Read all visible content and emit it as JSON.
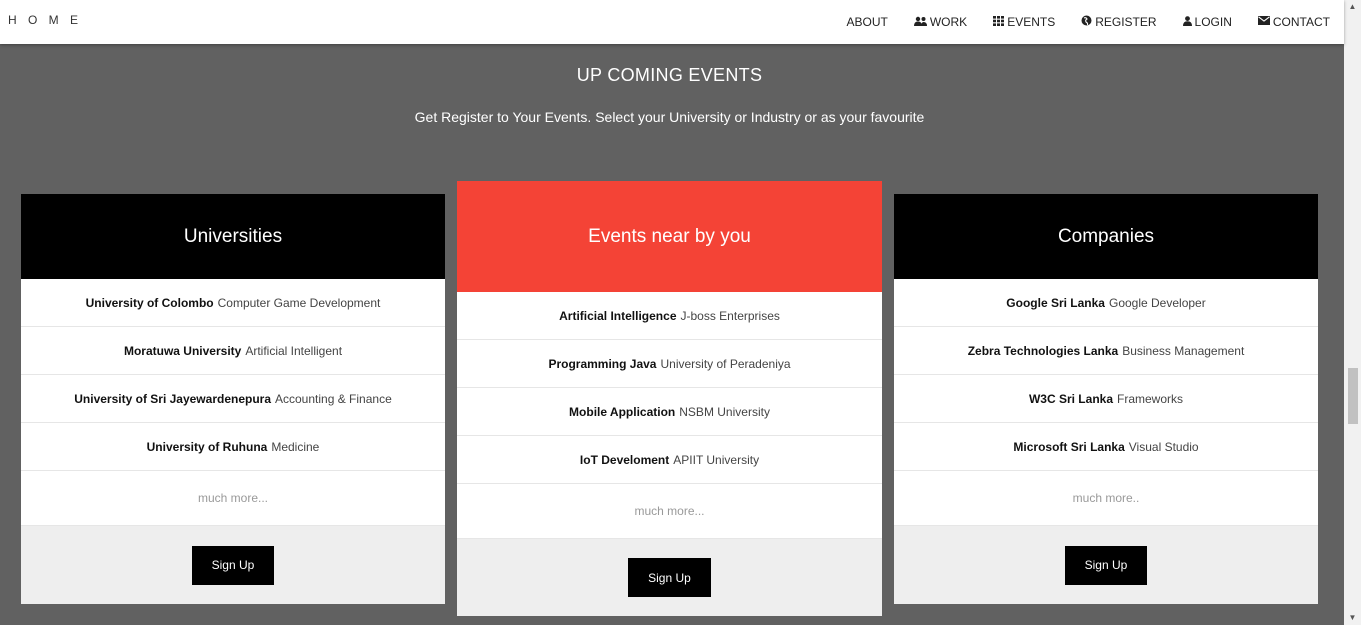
{
  "nav": {
    "brand": "H O M E",
    "items": [
      {
        "label": "ABOUT",
        "icon": ""
      },
      {
        "label": "WORK",
        "icon": "users-icon"
      },
      {
        "label": "EVENTS",
        "icon": "grid-icon"
      },
      {
        "label": "REGISTER",
        "icon": "globe-icon"
      },
      {
        "label": "LOGIN",
        "icon": "user-icon"
      },
      {
        "label": "CONTACT",
        "icon": "envelope-icon"
      }
    ]
  },
  "section": {
    "title": "UP COMING EVENTS",
    "subtitle": "Get Register to Your Events. Select your University or Industry or as your favourite"
  },
  "cards": [
    {
      "title": "Universities",
      "header_color": "#000000",
      "rows": [
        {
          "bold": "University of Colombo",
          "text": "Computer Game Development"
        },
        {
          "bold": "Moratuwa University",
          "text": "Artificial Intelligent"
        },
        {
          "bold": "University of Sri Jayewardenepura",
          "text": "Accounting & Finance"
        },
        {
          "bold": "University of Ruhuna",
          "text": "Medicine"
        }
      ],
      "more": "much more...",
      "button": "Sign Up"
    },
    {
      "title": "Events near by you",
      "header_color": "#f44336",
      "rows": [
        {
          "bold": "Artificial Intelligence",
          "text": "J-boss Enterprises"
        },
        {
          "bold": "Programming Java",
          "text": "University of Peradeniya"
        },
        {
          "bold": "Mobile Application",
          "text": "NSBM University"
        },
        {
          "bold": "IoT Develoment",
          "text": "APIIT University"
        }
      ],
      "more": "much more...",
      "button": "Sign Up"
    },
    {
      "title": "Companies",
      "header_color": "#000000",
      "rows": [
        {
          "bold": "Google Sri Lanka",
          "text": "Google Developer"
        },
        {
          "bold": "Zebra Technologies Lanka",
          "text": "Business Management"
        },
        {
          "bold": "W3C Sri Lanka",
          "text": "Frameworks"
        },
        {
          "bold": "Microsoft Sri Lanka",
          "text": "Visual Studio"
        }
      ],
      "more": "much more..",
      "button": "Sign Up"
    }
  ]
}
